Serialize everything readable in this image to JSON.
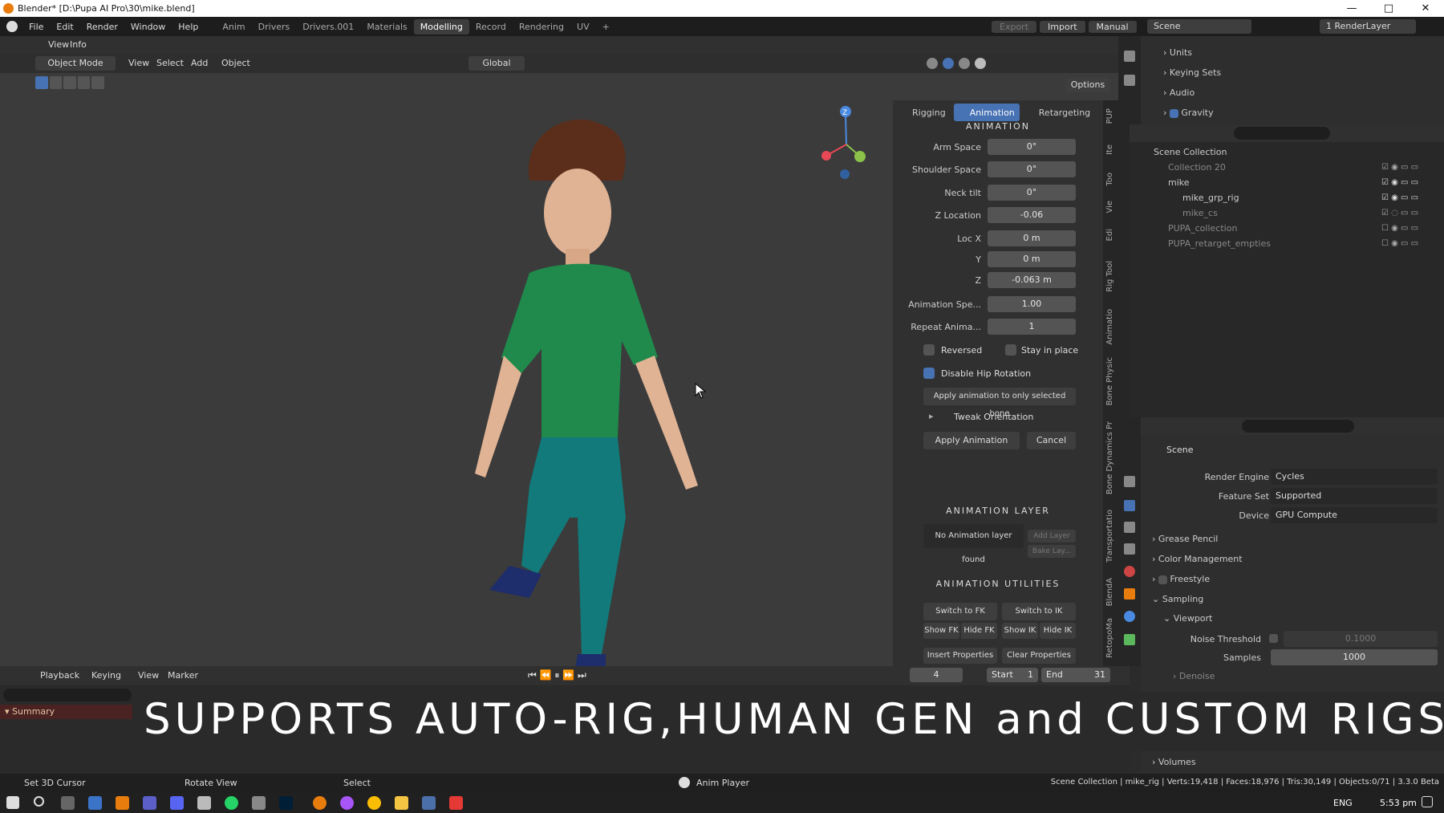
{
  "window": {
    "title": "Blender* [D:\\Pupa AI Pro\\30\\mike.blend]",
    "min": "—",
    "max": "□",
    "close": "✕"
  },
  "menu": [
    "File",
    "Edit",
    "Render",
    "Window",
    "Help"
  ],
  "workspaces": [
    "Anim",
    "Drivers",
    "Drivers.001",
    "Materials",
    "Modelling",
    "Record",
    "Rendering",
    "UV",
    "+"
  ],
  "topright": {
    "export": "Export",
    "import": "Import",
    "manual": "Manual",
    "scene": "Scene",
    "renderlayer": "1 RenderLayer"
  },
  "viewport": {
    "view": "View",
    "info": "Info",
    "mode": "Object Mode",
    "menus": [
      "View",
      "Select",
      "Add",
      "Object"
    ],
    "orientation": "Global",
    "options": "Options"
  },
  "npanel": {
    "tabs": [
      "Rigging",
      "Animation",
      "Retargeting"
    ],
    "section1": "ANIMATION",
    "fields": [
      {
        "label": "Arm Space",
        "value": "0°"
      },
      {
        "label": "Shoulder Space",
        "value": "0°"
      },
      {
        "label": "Neck tilt",
        "value": "0°"
      },
      {
        "label": "Z Location",
        "value": "-0.06"
      },
      {
        "label": "Loc X",
        "value": "0 m"
      },
      {
        "label": "Y",
        "value": "0 m"
      },
      {
        "label": "Z",
        "value": "-0.063 m"
      },
      {
        "label": "Animation Spe...",
        "value": "1.00"
      },
      {
        "label": "Repeat Anima...",
        "value": "1"
      }
    ],
    "reversed": "Reversed",
    "stay": "Stay in place",
    "disable_hip": "Disable Hip Rotation",
    "apply_selected": "Apply animation to only selected bone",
    "tweak": "Tweak Orientation",
    "apply": "Apply Animation",
    "cancel": "Cancel",
    "section2": "ANIMATION LAYER",
    "no_layer": "No Animation layer found",
    "add_layer": "Add Layer",
    "bake_layer": "Bake Lay...",
    "section3": "ANIMATION UTILITIES",
    "util": [
      "Switch to FK",
      "Switch to IK",
      "Show FK",
      "Hide FK",
      "Show IK",
      "Hide IK",
      "Insert Properties ...",
      "Clear Properties K..."
    ],
    "vtabs": [
      "Ite",
      "Too",
      "Vie",
      "Edi",
      "Rig Tool",
      "Animatio",
      "Bone Physic",
      "Bone Dynamics Pr",
      "Transportatio",
      "BlendA",
      "RetopoMa",
      "PUP"
    ]
  },
  "props_top": {
    "items": [
      "Units",
      "Keying Sets",
      "Audio",
      "Gravity"
    ]
  },
  "outliner": {
    "items": [
      {
        "label": "Scene Collection",
        "depth": 0
      },
      {
        "label": "Collection 20",
        "depth": 1
      },
      {
        "label": "mike",
        "depth": 1
      },
      {
        "label": "mike_grp_rig",
        "depth": 2
      },
      {
        "label": "mike_cs",
        "depth": 2
      },
      {
        "label": "PUPA_collection",
        "depth": 1
      },
      {
        "label": "PUPA_retarget_empties",
        "depth": 1
      }
    ]
  },
  "props": {
    "scene": "Scene",
    "rows": [
      {
        "label": "Render Engine",
        "value": "Cycles"
      },
      {
        "label": "Feature Set",
        "value": "Supported"
      },
      {
        "label": "Device",
        "value": "GPU Compute"
      }
    ],
    "panels": [
      "Grease Pencil",
      "Color Management",
      "Freestyle"
    ],
    "sampling": "Sampling",
    "viewport": "Viewport",
    "noise": {
      "label": "Noise Threshold",
      "value": "0.1000"
    },
    "samples": {
      "label": "Samples",
      "value": "1000"
    },
    "denoise": "Denoise",
    "volumes": "Volumes"
  },
  "timeline": {
    "menus": [
      "Playback",
      "Keying",
      "View",
      "Marker"
    ],
    "frame": "4",
    "start_lbl": "Start",
    "start": "1",
    "end_lbl": "End",
    "end": "31",
    "summary": "Summary"
  },
  "overlay_text": "SUPPORTS AUTO-RIG,HUMAN GEN and CUSTOM RIGS",
  "status": {
    "left": "Set 3D Cursor",
    "mid": "Rotate View",
    "sel": "Select",
    "player": "Anim Player",
    "right": "Scene Collection | mike_rig | Verts:19,418 | Faces:18,976 | Tris:30,149 | Objects:0/71 | 3.3.0 Beta"
  },
  "taskbar": {
    "lang": "ENG",
    "time": "5:53 pm"
  },
  "colors": {
    "accent": "#4772b3",
    "shirt": "#1f8a4c",
    "pants": "#127a7a",
    "hair": "#5a2e1a",
    "skin": "#e0b394"
  }
}
